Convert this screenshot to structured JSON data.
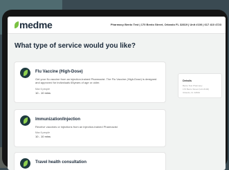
{
  "header": {
    "logo_text": "medme",
    "pharmacy_info": "Pharmacy Bento Test | 170 Bento Street, Orlando FL 32819 | Unit #100 | 617 410 4723"
  },
  "page_title": "What type of service would you like?",
  "services": [
    {
      "title": "Flu Vaccine (High-Dose)",
      "description": "Get your flu vaccine from an injection-trained Pharmacist. The Flu Vaccine (High-Dose) is designed and approved for individuals 65years of age or older.",
      "meta": "Max 6 people",
      "duration": "10 - 10 mins"
    },
    {
      "title": "Immunization/Injection",
      "description": "Receive vaccines or injections from an injection-trained Pharmacist",
      "meta": "Max 6 people",
      "duration": "10 - 10 mins"
    },
    {
      "title": "Travel health consultation",
      "description": "",
      "meta": "",
      "duration": ""
    }
  ],
  "details": {
    "title": "Details",
    "lines": [
      "Bento Test Pharmacy",
      "170 Bento Street (Unit #100)",
      "Orlando, FL 32819"
    ]
  }
}
